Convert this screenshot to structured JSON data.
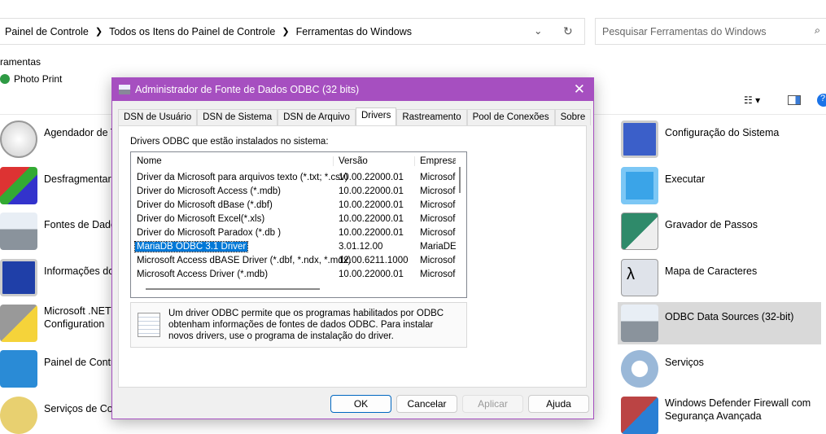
{
  "breadcrumb": [
    "Painel de Controle",
    "Todos os Itens do Painel de Controle",
    "Ferramentas do Windows"
  ],
  "search": {
    "placeholder": "Pesquisar Ferramentas do Windows"
  },
  "nav": {
    "partial": "ramentas",
    "photo_print": "Photo Print"
  },
  "left_items": [
    "Agendador de T",
    "Desfragmentar",
    "Fontes de Dado",
    "Informações do",
    "Microsoft .NET\nConfiguration",
    "Painel de Contr",
    "Serviços de Con"
  ],
  "right_items": [
    "Configuração do Sistema",
    "Executar",
    "Gravador de Passos",
    "Mapa de Caracteres",
    "ODBC Data Sources (32-bit)",
    "Serviços",
    "Windows Defender Firewall com Segurança Avançada"
  ],
  "dialog": {
    "title": "Administrador de Fonte de Dados ODBC (32 bits)",
    "tabs": [
      "DSN de Usuário",
      "DSN de Sistema",
      "DSN de Arquivo",
      "Drivers",
      "Rastreamento",
      "Pool de Conexões",
      "Sobre"
    ],
    "active_tab": "Drivers",
    "list_label": "Drivers ODBC que estão instalados no sistema:",
    "columns": [
      "Nome",
      "Versão",
      "Empresa"
    ],
    "rows": [
      [
        "Driver da Microsoft para arquivos texto (*.txt; *.csv)",
        "10.00.22000.01",
        "Microsof"
      ],
      [
        "Driver do Microsoft Access (*.mdb)",
        "10.00.22000.01",
        "Microsof"
      ],
      [
        "Driver do Microsoft dBase (*.dbf)",
        "10.00.22000.01",
        "Microsof"
      ],
      [
        "Driver do Microsoft Excel(*.xls)",
        "10.00.22000.01",
        "Microsof"
      ],
      [
        "Driver do Microsoft Paradox (*.db )",
        "10.00.22000.01",
        "Microsof"
      ],
      [
        "MariaDB ODBC 3.1 Driver",
        "3.01.12.00",
        "MariaDE"
      ],
      [
        "Microsoft Access dBASE Driver (*.dbf, *.ndx, *.mdx)",
        "12.00.6211.1000",
        "Microsof"
      ],
      [
        "Microsoft Access Driver (*.mdb)",
        "10.00.22000.01",
        "Microsof"
      ]
    ],
    "selected_row": 5,
    "info": "Um driver ODBC permite que os programas habilitados por ODBC obtenham informações de fontes de dados ODBC. Para instalar novos drivers, use o programa de instalação do driver.",
    "buttons": {
      "ok": "OK",
      "cancel": "Cancelar",
      "apply": "Aplicar",
      "help": "Ajuda"
    }
  },
  "colors": {
    "accent": "#a64fc0",
    "selection": "#0078d7"
  }
}
